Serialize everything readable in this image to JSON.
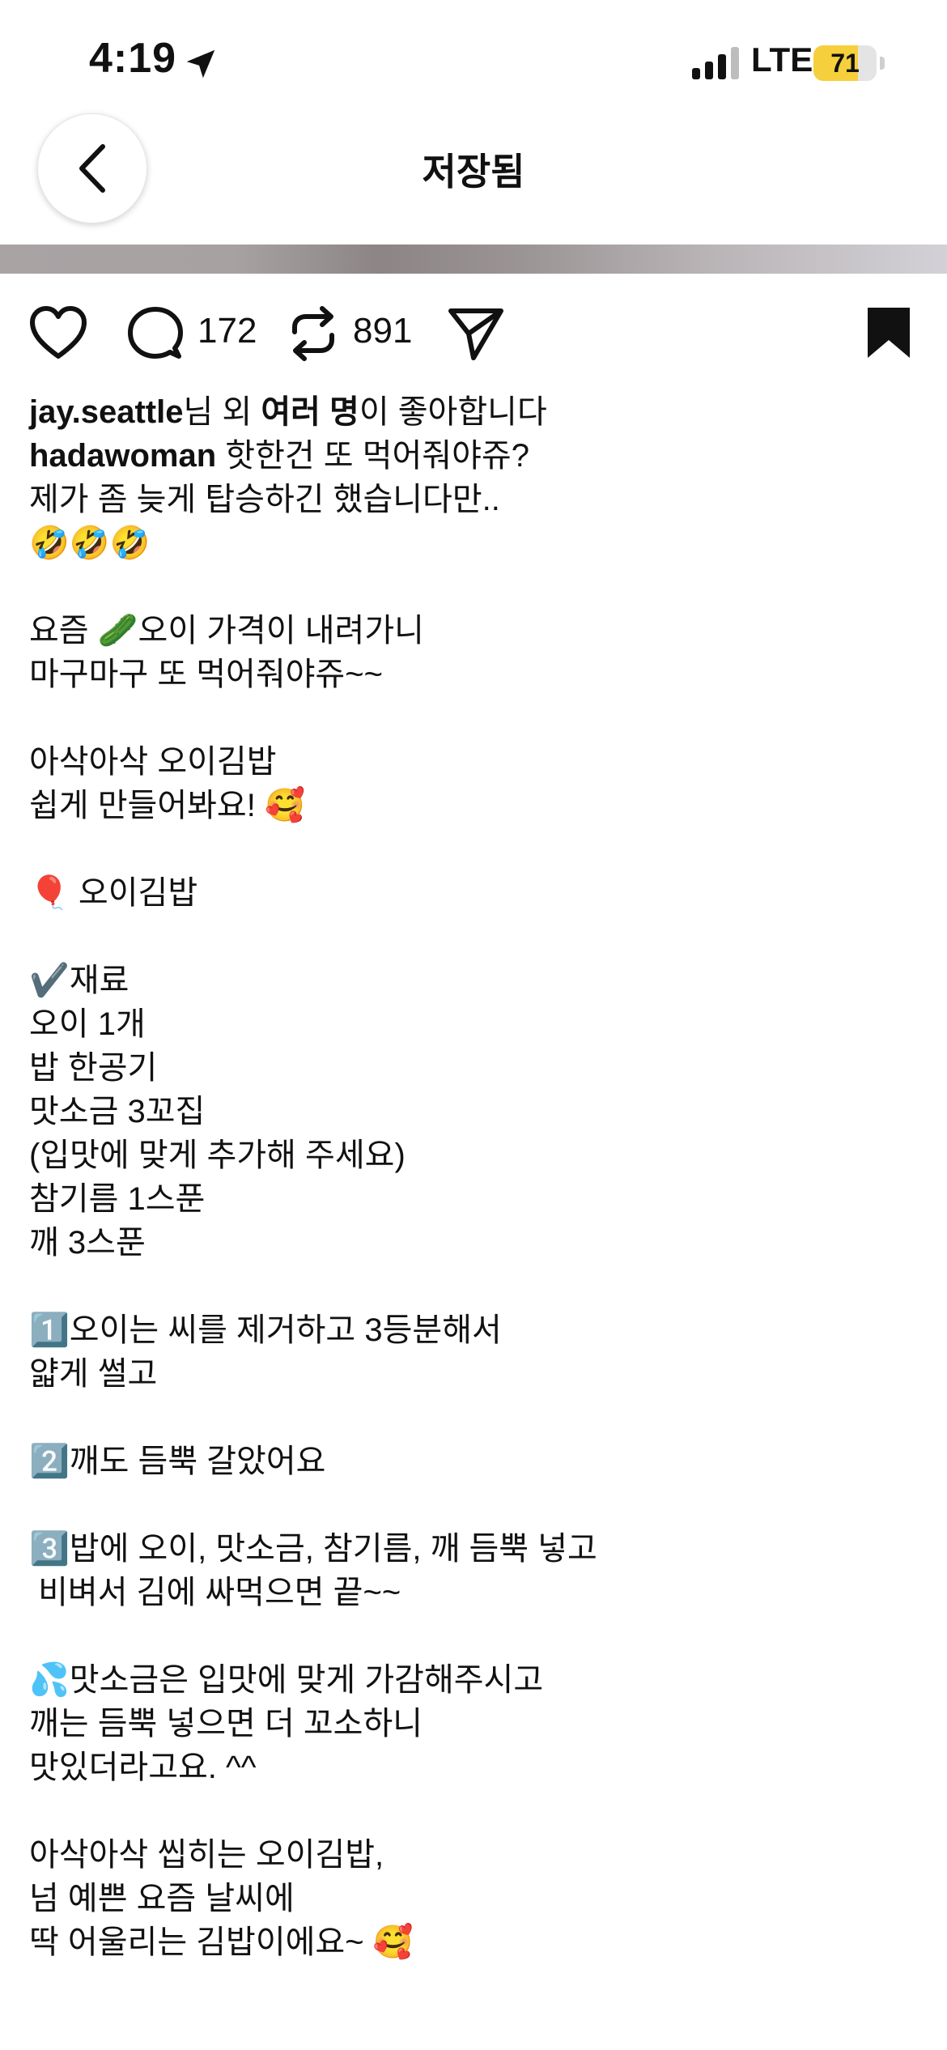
{
  "status_bar": {
    "time": "4:19",
    "network": "LTE",
    "battery_percent": "71",
    "battery_level": 0.71,
    "battery_color": "#f6cf3c"
  },
  "nav": {
    "title": "저장됨",
    "back_icon": "chevron-left-icon"
  },
  "actions": {
    "like_icon": "heart-icon",
    "comment_icon": "comment-icon",
    "comment_count": "172",
    "repost_icon": "repost-icon",
    "repost_count": "891",
    "share_icon": "send-icon",
    "save_icon": "bookmark-filled-icon"
  },
  "likes": {
    "user": "jay.seattle",
    "mid": "님 외 ",
    "others": "여러 명",
    "tail": "이 좋아합니다"
  },
  "caption": {
    "username": "hadawoman",
    "first_line": " 핫한건 또 먹어줘야쥬?",
    "body": "\n제가 좀 늦게 탑승하긴 했습니다만..\n🤣🤣🤣\n\n요즘 🥒오이 가격이 내려가니\n마구마구 또 먹어줘야쥬~~\n\n아삭아삭 오이김밥\n쉽게 만들어봐요! 🥰\n\n🎈 오이김밥\n\n✔️재료\n오이 1개\n밥 한공기\n맛소금 3꼬집\n(입맛에 맞게 추가해 주세요)\n참기름 1스푼\n깨 3스푼\n\n1️⃣오이는 씨를 제거하고 3등분해서\n얇게 썰고\n\n2️⃣깨도 듬뿍 갈았어요\n\n3️⃣밥에 오이, 맛소금, 참기름, 깨 듬뿍 넣고\n 비벼서 김에 싸먹으면 끝~~\n\n💦맛소금은 입맛에 맞게 가감해주시고\n깨는 듬뿍 넣으면 더 꼬소하니\n맛있더라고요. ^^\n\n아삭아삭 씹히는 오이김밥,\n넘 예쁜 요즘 날씨에\n딱 어울리는 김밥이에요~ 🥰"
  }
}
